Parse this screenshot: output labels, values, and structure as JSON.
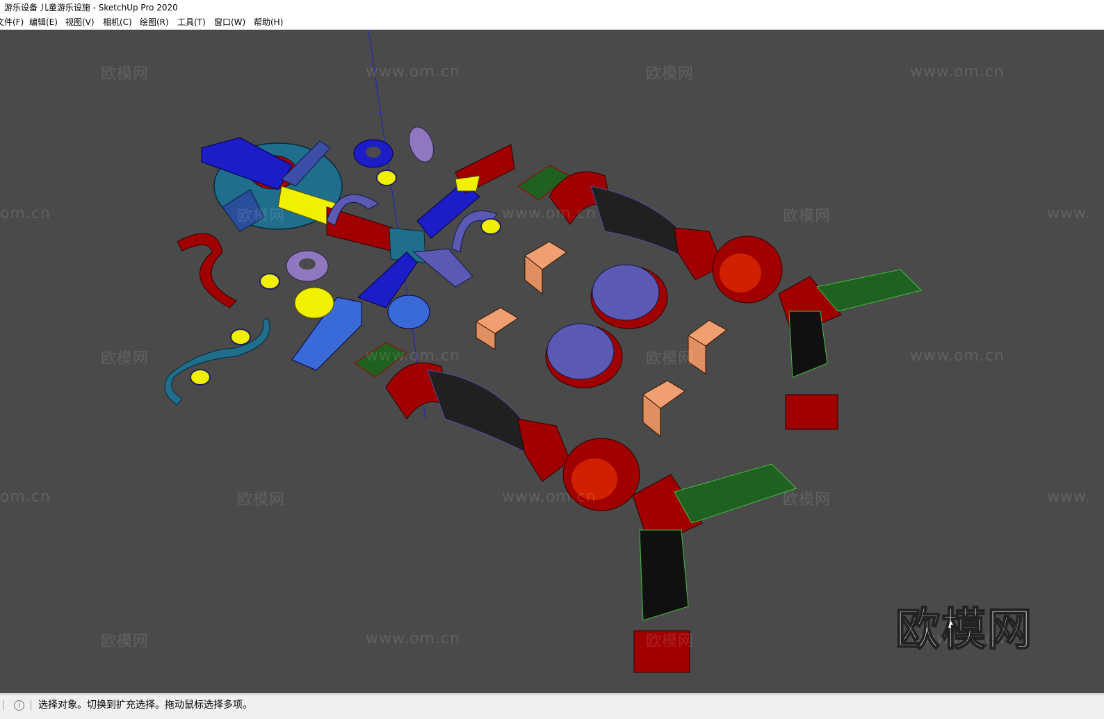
{
  "window": {
    "title": "游乐设备 儿童游乐设施 - SketchUp Pro 2020"
  },
  "menu": [
    {
      "label": "文件(F)"
    },
    {
      "label": "编辑(E)"
    },
    {
      "label": "视图(V)"
    },
    {
      "label": "相机(C)"
    },
    {
      "label": "绘图(R)"
    },
    {
      "label": "工具(T)"
    },
    {
      "label": "窗口(W)"
    },
    {
      "label": "帮助(H)"
    }
  ],
  "viewport": {
    "background": "#4a4a4a",
    "watermark_cn": "欧模网",
    "watermark_url": "www.om.cn",
    "watermark_url_partial_left": "om.cn",
    "watermark_url_partial_right": "www.",
    "logo_text": "欧模网",
    "colors": {
      "red": "#a00000",
      "blue": "#1c1cc8",
      "yellow": "#f0f000",
      "teal": "#1e6e8c",
      "purple": "#9078c0",
      "green": "#206020",
      "salmon": "#f0a070",
      "slate": "#5a5ab4",
      "axis": "#2020c0"
    }
  },
  "status": {
    "info_icon": "info-icon",
    "message": "选择对象。切换到扩充选择。拖动鼠标选择多项。"
  }
}
